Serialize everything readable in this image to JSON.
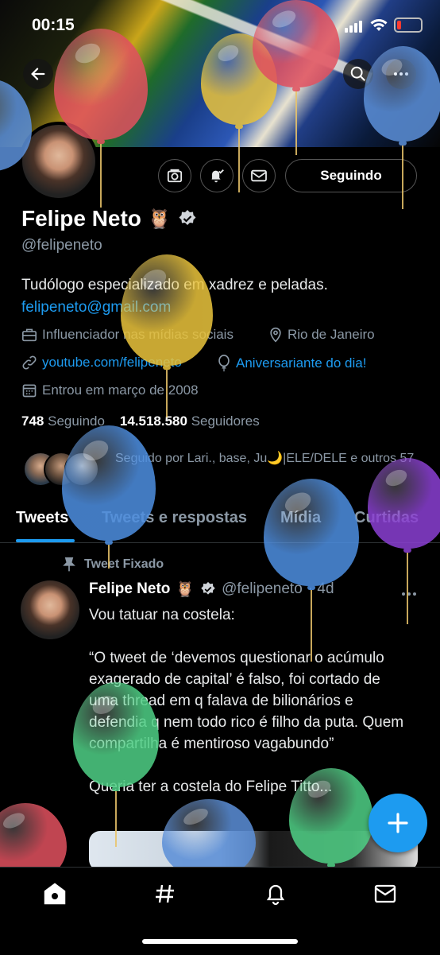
{
  "status_bar": {
    "time": "00:15"
  },
  "profile": {
    "name": "Felipe Neto",
    "handle": "@felipeneto",
    "bio_line1": "Tudólogo especializado em xadrez e peladas.",
    "bio_email": "felipeneto@gmail.com",
    "category": "Influenciador nas mídias sociais",
    "location": "Rio de Janeiro",
    "website": "youtube.com/felipeneto",
    "birthday": "Aniversariante do dia!",
    "joined": "Entrou em março de 2008",
    "following_count": "748",
    "following_label": "Seguindo",
    "followers_count": "14.518.580",
    "followers_label": "Seguidores",
    "followed_by": "Seguido por Lari., base, Ju🌙|ELE/DELE e outros 57",
    "follow_button": "Seguindo"
  },
  "tabs": [
    {
      "label": "Tweets",
      "active": true
    },
    {
      "label": "Tweets e respostas",
      "active": false
    },
    {
      "label": "Mídia",
      "active": false
    },
    {
      "label": "Curtidas",
      "active": false
    }
  ],
  "tweet": {
    "pinned_label": "Tweet Fixado",
    "author_name": "Felipe Neto",
    "author_handle": "@felipeneto",
    "time": "· 4d",
    "paragraph1": "Vou tatuar na costela:",
    "paragraph2": "“O tweet de ‘devemos questionar o acúmulo exagerado de capital’ é falso, foi cortado de uma thread em q falava de bilionários e defendia q nem todo rico é filho da puta. Quem compartilha é mentiroso vagabundo”",
    "paragraph3": "Queria ter a costela do Felipe Titto..."
  },
  "emoji": {
    "owl": "🦉"
  },
  "icons": [
    "back-arrow-icon",
    "search-icon",
    "more-icon",
    "camera-icon",
    "bell-icon",
    "mail-icon",
    "verified-icon",
    "briefcase-icon",
    "location-icon",
    "link-icon",
    "balloon-icon",
    "calendar-icon",
    "pin-icon",
    "compose-icon",
    "home-icon",
    "hashtag-icon",
    "notifications-icon",
    "messages-icon"
  ],
  "colors": {
    "accent": "#1d9bf0",
    "background": "#000000",
    "secondary_text": "#8b98a5"
  }
}
